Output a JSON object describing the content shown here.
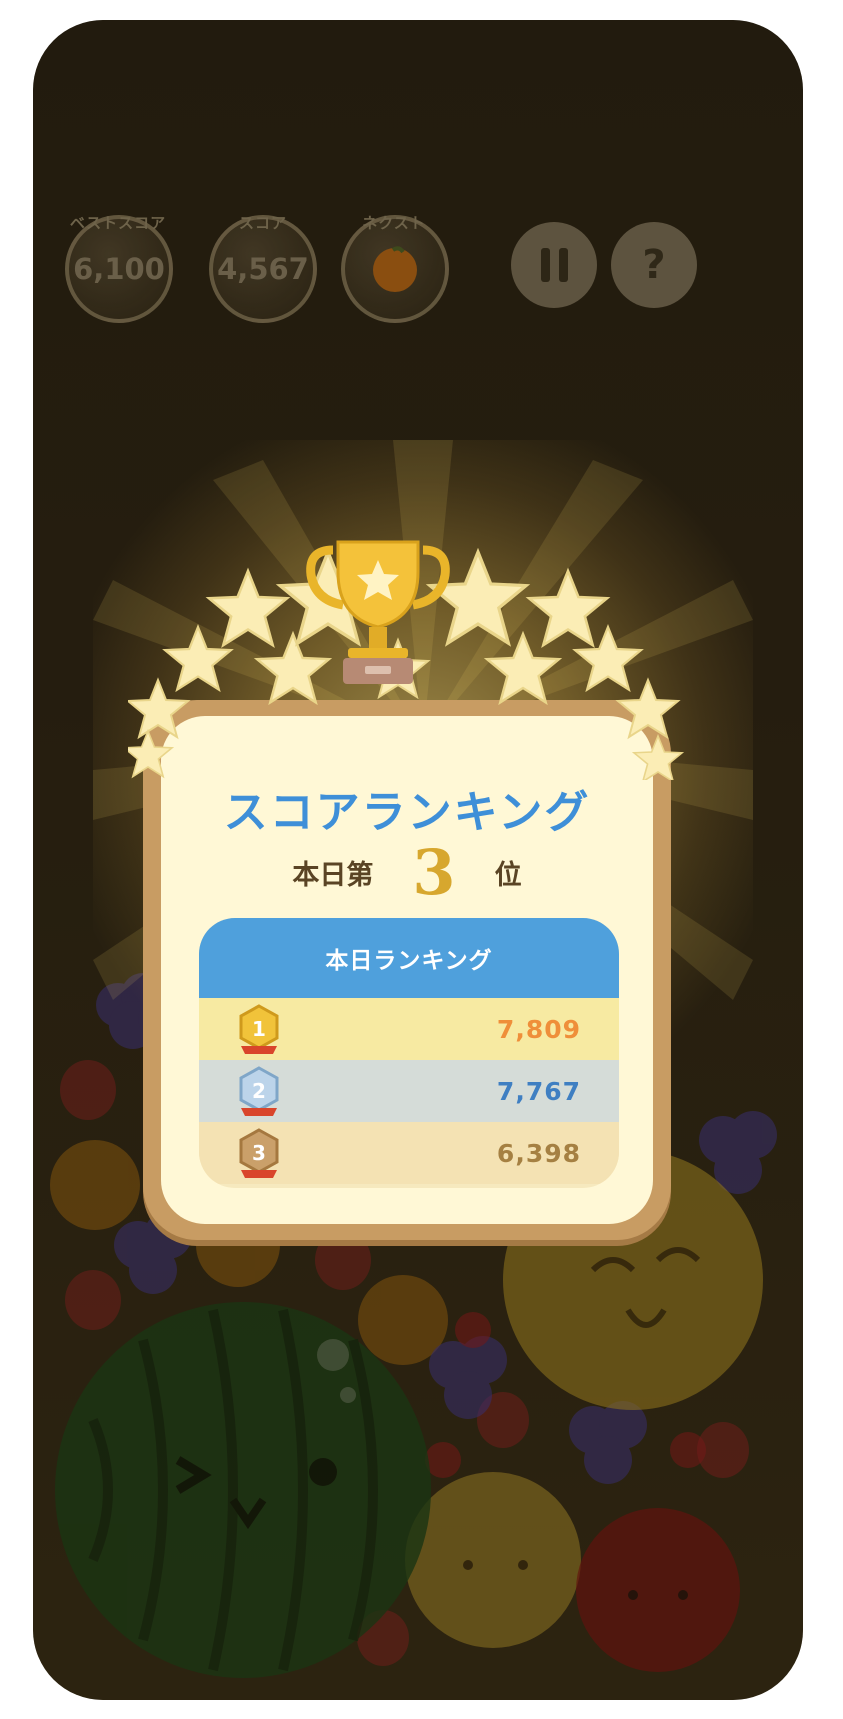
{
  "hud": {
    "best_label": "ベストスコア",
    "best_value": "6,100",
    "score_label": "スコア",
    "score_value": "4,567",
    "next_label": "ネクスト",
    "help_symbol": "?"
  },
  "modal": {
    "title": "スコアランキング",
    "rank_prefix": "本日第",
    "rank_number": "3",
    "rank_suffix": "位",
    "table_header": "本日ランキング",
    "rows": [
      {
        "rank": "1",
        "score": "7,809",
        "color": "#ef8f3a"
      },
      {
        "rank": "2",
        "score": "7,767",
        "color": "#3f7fc2"
      },
      {
        "rank": "3",
        "score": "6,398",
        "color": "#a58042"
      }
    ]
  },
  "icons": {
    "pause": "pause-icon",
    "help": "question-icon",
    "trophy": "trophy-icon",
    "next_fruit": "orange-fruit-icon"
  },
  "colors": {
    "accent_blue": "#3e8fd8",
    "gold": "#d7a72e",
    "card_bg": "#fff8d6"
  }
}
